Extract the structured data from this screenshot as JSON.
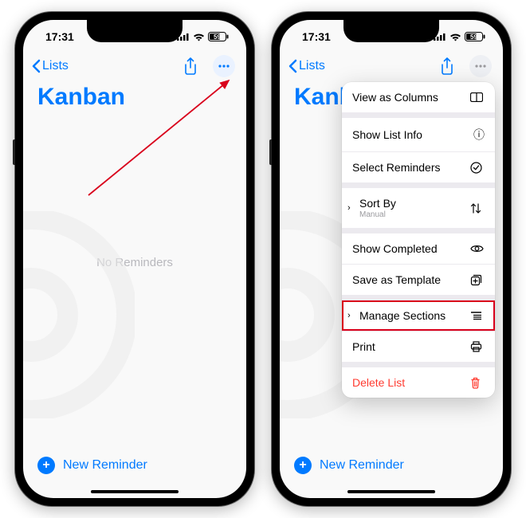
{
  "status": {
    "time": "17:31",
    "battery_symbol": "59"
  },
  "nav": {
    "back_label": "Lists"
  },
  "title": "Kanban",
  "empty_text": "No Reminders",
  "footer": {
    "new_reminder": "New Reminder"
  },
  "menu": {
    "view_columns": "View as Columns",
    "show_info": "Show List Info",
    "select": "Select Reminders",
    "sort_by": "Sort By",
    "sort_by_sub": "Manual",
    "show_completed": "Show Completed",
    "save_template": "Save as Template",
    "manage_sections": "Manage Sections",
    "print": "Print",
    "delete": "Delete List"
  }
}
